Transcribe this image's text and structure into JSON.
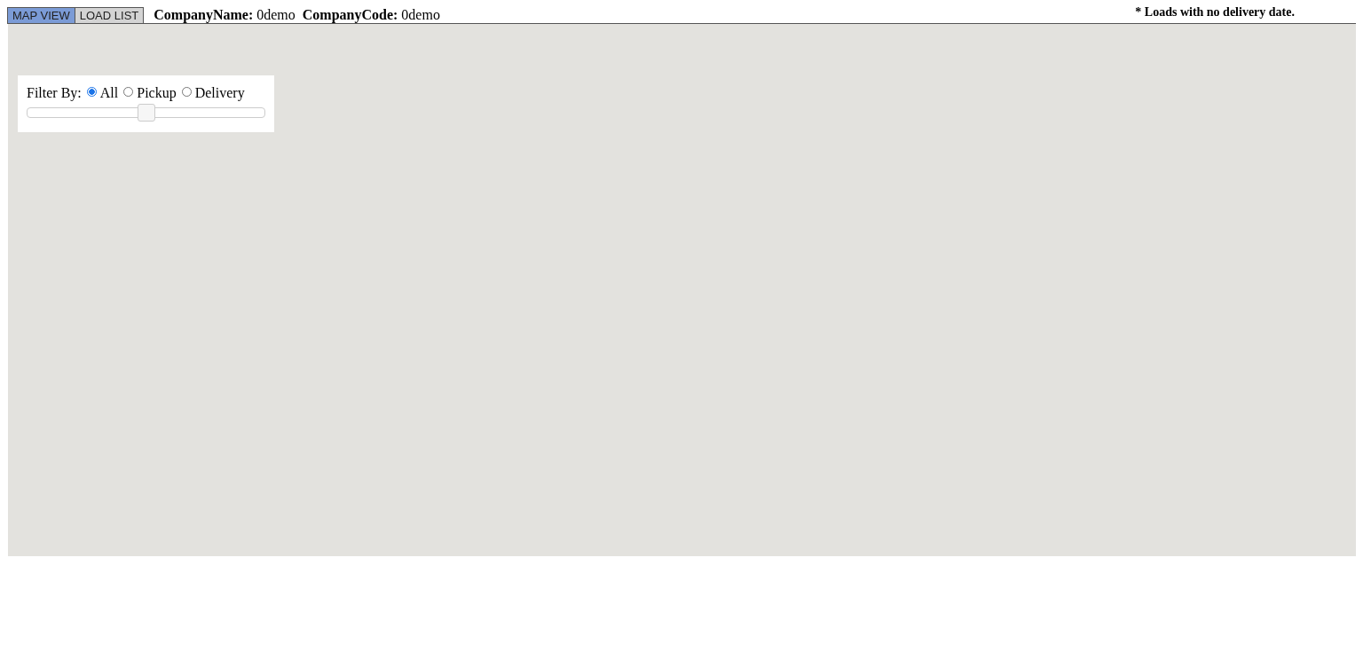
{
  "tabs": [
    {
      "label": "MAP VIEW",
      "selected": true
    },
    {
      "label": "LOAD LIST",
      "selected": false
    }
  ],
  "company_fields": [
    {
      "label": "CompanyName:",
      "value": "0demo"
    },
    {
      "label": "CompanyCode:",
      "value": "0demo"
    }
  ],
  "note": "* Loads with no delivery date.",
  "filter": {
    "label": "Filter By:",
    "options": [
      {
        "label": "All",
        "selected": true
      },
      {
        "label": "Pickup",
        "selected": false
      },
      {
        "label": "Delivery",
        "selected": false
      }
    ],
    "slider": {
      "level": 0.5
    }
  }
}
